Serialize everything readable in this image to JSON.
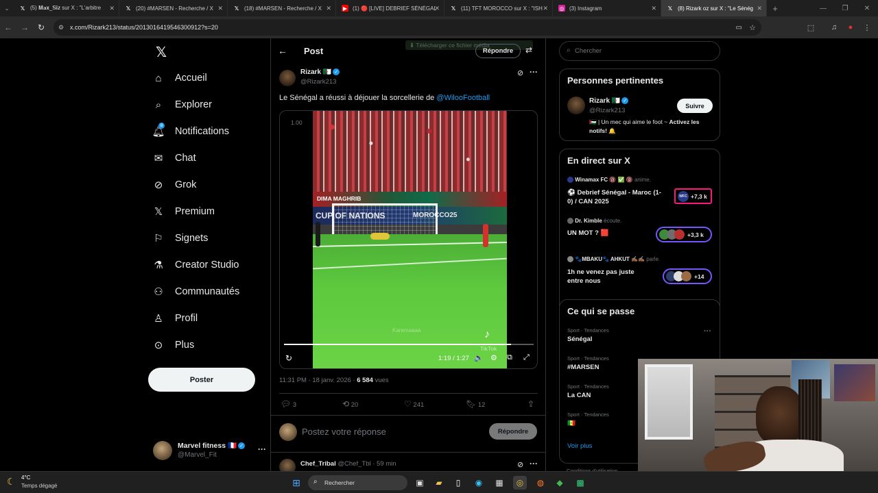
{
  "browser": {
    "tabs": [
      {
        "label": "(5) 𝐌𝐚𝐱_𝐒𝐢𝐳 sur X : \"L'arbitre",
        "favicon": "x-logo-icon"
      },
      {
        "label": "(20) #MARSEN - Recherche / X",
        "favicon": "x-logo-icon"
      },
      {
        "label": "(18) #MARSEN - Recherche / X",
        "favicon": "x-logo-icon"
      },
      {
        "label": "(1) 🔴 [LIVE] DEBRIEF SÉNÉGAL",
        "favicon": "youtube-icon"
      },
      {
        "label": "(11) TFT MOROCCO sur X : \"ISH",
        "favicon": "x-logo-icon"
      },
      {
        "label": "(3) Instagram",
        "favicon": "instagram-icon"
      },
      {
        "label": "(8) Rizark oz sur X : \"Le Sénég",
        "favicon": "x-logo-icon"
      }
    ],
    "url": "x.com/Rizark213/status/2013016419546300912?s=20"
  },
  "nav": {
    "items": [
      {
        "label": "Accueil",
        "icon": "home-icon"
      },
      {
        "label": "Explorer",
        "icon": "search-icon"
      },
      {
        "label": "Notifications",
        "icon": "bell-icon",
        "badge": "8"
      },
      {
        "label": "Chat",
        "icon": "mail-icon"
      },
      {
        "label": "Grok",
        "icon": "grok-icon"
      },
      {
        "label": "Premium",
        "icon": "x-logo-icon"
      },
      {
        "label": "Signets",
        "icon": "bookmark-icon"
      },
      {
        "label": "Creator Studio",
        "icon": "flask-icon"
      },
      {
        "label": "Communautés",
        "icon": "people-icon"
      },
      {
        "label": "Profil",
        "icon": "person-icon"
      },
      {
        "label": "Plus",
        "icon": "more-circle-icon"
      }
    ],
    "post_button": "Poster",
    "account": {
      "name": "Marvel fitness 🇫🇷",
      "handle": "@Marvel_Fit"
    }
  },
  "post": {
    "header_title": "Post",
    "reply_label": "Répondre",
    "overlay_text": "⬇ Télécharger ce fichier média",
    "author": {
      "name": "Rizark 🇩🇿",
      "handle": "@Rizark213"
    },
    "text_prefix": "Le Sénégal a réussi à déjouer la sorcellerie de ",
    "mention": "@WilooFootball",
    "video": {
      "speed": "1.00",
      "time": "1:19 / 1:27",
      "watermark": "TikTok",
      "tiktok_user": "Karemaaaa",
      "banner_text": "CUP OF NATIONS",
      "banner_text2": "MOROCCO25",
      "banner_text3": "DIMA MAGHRIB",
      "progress": 0.91
    },
    "timestamp": "11:31 PM · 18 janv. 2026 · ",
    "views_count": "6 584",
    "views_label": " vues",
    "stats": {
      "replies": "3",
      "reposts": "20",
      "likes": "241",
      "bookmarks": "12"
    },
    "reply_placeholder": "Postez votre réponse",
    "reply_button": "Répondre",
    "next_reply": {
      "name": "Chef_Tribal",
      "handle": "@Chef_Tbl · 59 min"
    }
  },
  "sidebar": {
    "search_placeholder": "Chercher",
    "relevant": {
      "title": "Personnes pertinentes",
      "name": "Rizark 🇩🇿",
      "handle": "@Rizark213",
      "bio_prefix": "🇵🇸 | Un mec qui aime le foot ~ ",
      "bio_bold": "Activez les notifs!",
      "bio_suffix": " 🔔",
      "follow": "Suivre"
    },
    "live": {
      "title": "En direct sur X",
      "spaces": [
        {
          "host": "Winamax FC",
          "host_extra": " 🔞 ✅ 🔞",
          "status": "anime.",
          "title": "⚽ Debrief Sénégal - Maroc (1-0) / CAN 2025",
          "count": "+7,3 k",
          "pill_label": "WFC"
        },
        {
          "host": "Dr. Kimble",
          "host_extra": "",
          "status": "écoute.",
          "title": "UN MOT ? 🟥",
          "count": "+3,3 k",
          "pill_label": ""
        },
        {
          "host": "🐾MBAKU🐾 AHKUT ✍🏾✍🏾",
          "host_extra": "",
          "status": "parle.",
          "title": "1h ne venez pas juste entre nous",
          "count": "+14",
          "pill_label": ""
        }
      ]
    },
    "trends": {
      "title": "Ce qui se passe",
      "items": [
        {
          "category": "Sport · Tendances",
          "name": "Sénégal"
        },
        {
          "category": "Sport · Tendances",
          "name": "#MARSEN"
        },
        {
          "category": "Sport · Tendances",
          "name": "La CAN"
        },
        {
          "category": "Sport · Tendances",
          "name": "🇸🇳"
        }
      ],
      "show_more": "Voir plus"
    },
    "footer": "Conditions d'utilisation"
  },
  "taskbar": {
    "weather_temp": "4°C",
    "weather_desc": "Temps dégagé",
    "search_label": "Rechercher"
  },
  "colors": {
    "accent": "#1d9bf0",
    "background": "#000000",
    "border": "#2f3336",
    "text": "#e7e9ea",
    "muted": "#71767b"
  }
}
